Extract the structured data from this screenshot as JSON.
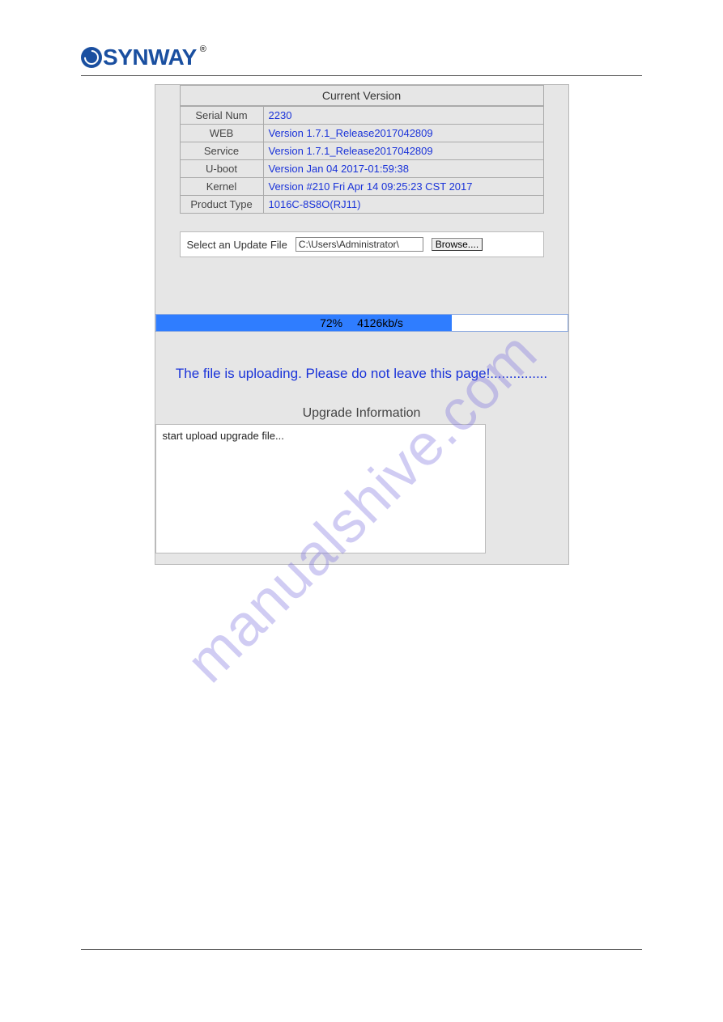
{
  "logo_text": "YNWAY",
  "version": {
    "title": "Current Version",
    "rows": [
      {
        "label": "Serial Num",
        "value": "2230"
      },
      {
        "label": "WEB",
        "value": "Version 1.7.1_Release2017042809"
      },
      {
        "label": "Service",
        "value": "Version 1.7.1_Release2017042809"
      },
      {
        "label": "U-boot",
        "value": "Version Jan 04 2017-01:59:38"
      },
      {
        "label": "Kernel",
        "value": "Version #210 Fri Apr 14 09:25:23 CST 2017"
      },
      {
        "label": "Product Type",
        "value": "1016C-8S8O(RJ11)"
      }
    ]
  },
  "select": {
    "label": "Select an Update File",
    "path": "C:\\Users\\Administrator\\",
    "browse": "Browse...."
  },
  "progress": {
    "percent": "72%",
    "speed": "4126kb/s"
  },
  "upload_message": "The file is uploading. Please do not leave this page!...............",
  "upgrade": {
    "title": "Upgrade Information",
    "log": "start upload upgrade file..."
  },
  "watermark": "manualshive.com"
}
